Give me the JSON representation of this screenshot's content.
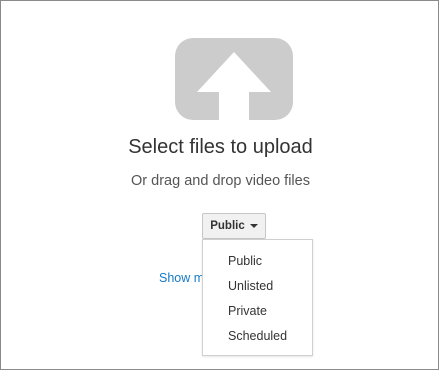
{
  "upload": {
    "icon": "upload-arrow-icon",
    "title": "Select files to upload",
    "subtitle": "Or drag and drop video files"
  },
  "privacy": {
    "selected": "Public",
    "options": [
      "Public",
      "Unlisted",
      "Private",
      "Scheduled"
    ]
  },
  "show_more": {
    "label": "Show more"
  },
  "colors": {
    "icon_gray": "#cccccc",
    "link_blue": "#167ac6",
    "button_bg": "#f1f1f1",
    "text": "#333333"
  }
}
